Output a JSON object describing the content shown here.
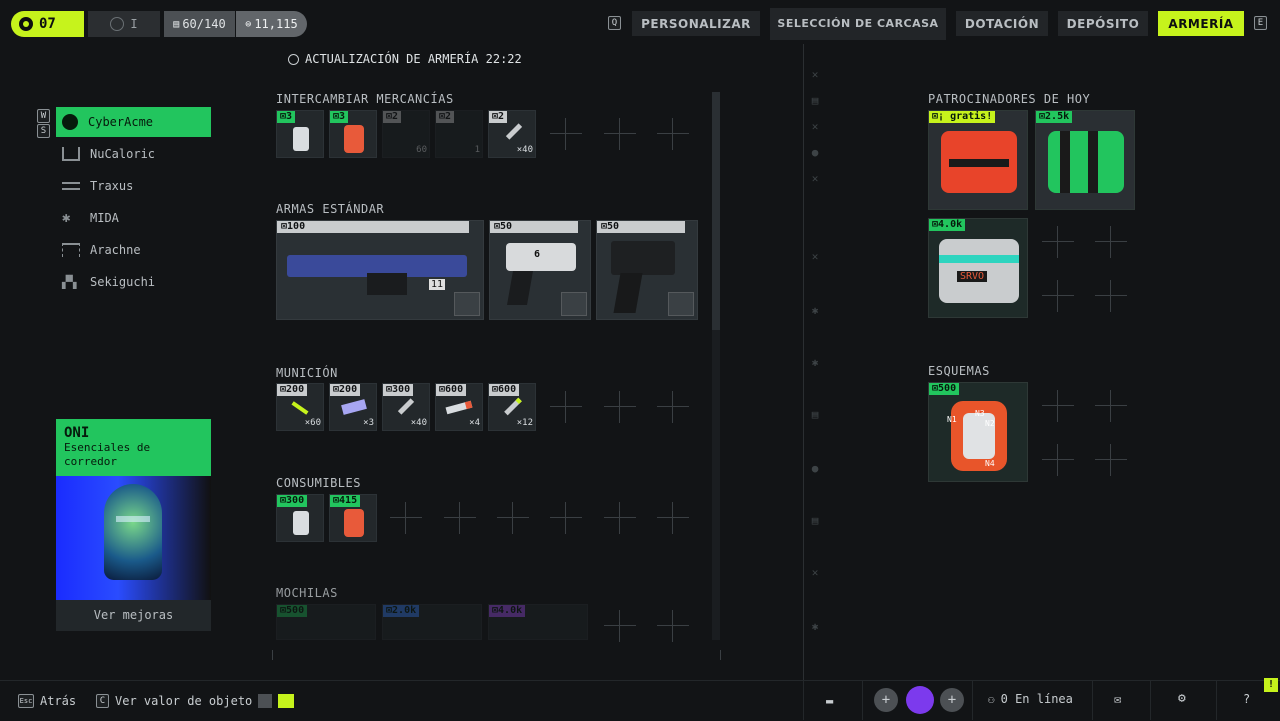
{
  "top": {
    "level": "07",
    "rank": "I",
    "capacity": "60/140",
    "credits": "11,115",
    "key_left": "Q",
    "key_right": "E",
    "nav": [
      "PERSONALIZAR",
      "SELECCIÓN DE CARCASA",
      "DOTACIÓN",
      "DEPÓSITO",
      "ARMERÍA"
    ],
    "active_nav": "ARMERÍA"
  },
  "armory": {
    "update_label": "ACTUALIZACIÓN DE ARMERÍA 22:22",
    "key_w": "W",
    "key_s": "S"
  },
  "factions": [
    "CyberAcme",
    "NuCaloric",
    "Traxus",
    "MIDA",
    "Arachne",
    "Sekiguchi"
  ],
  "promo": {
    "title": "ONI",
    "subtitle": "Esenciales de corredor",
    "button": "Ver mejoras"
  },
  "sections": {
    "trade": {
      "title": "INTERCAMBIAR MERCANCÍAS",
      "items": [
        {
          "price": "3",
          "qty": ""
        },
        {
          "price": "3",
          "qty": ""
        },
        {
          "price": "2",
          "qty": "60"
        },
        {
          "price": "2",
          "qty": "1"
        },
        {
          "price": "2",
          "qty": "×40"
        }
      ]
    },
    "weapons": {
      "title": "ARMAS ESTÁNDAR",
      "items": [
        {
          "price": "100",
          "tag": "11"
        },
        {
          "price": "50",
          "tag": "6"
        },
        {
          "price": "50",
          "tag": ""
        }
      ]
    },
    "ammo": {
      "title": "MUNICIÓN",
      "items": [
        {
          "price": "200",
          "qty": "×60"
        },
        {
          "price": "200",
          "qty": "×3"
        },
        {
          "price": "300",
          "qty": "×40"
        },
        {
          "price": "600",
          "qty": "×4"
        },
        {
          "price": "600",
          "qty": "×12"
        }
      ]
    },
    "consumables": {
      "title": "CONSUMIBLES",
      "items": [
        {
          "price": "300"
        },
        {
          "price": "415"
        }
      ]
    },
    "backpacks": {
      "title": "MOCHILAS",
      "items": [
        {
          "price": "500"
        },
        {
          "price": "2.0k"
        },
        {
          "price": "4.0k"
        }
      ]
    }
  },
  "sponsors": {
    "title": "PATROCINADORES DE HOY",
    "items": [
      {
        "price": "¡ gratis!",
        "tag": ""
      },
      {
        "price": "2.5k",
        "tag": ""
      },
      {
        "price": "4.0k",
        "tag": "SRVO"
      }
    ]
  },
  "schemes": {
    "title": "ESQUEMAS",
    "items": [
      {
        "price": "500",
        "tags": [
          "N1",
          "N2",
          "N3",
          "N4"
        ]
      }
    ]
  },
  "bottom": {
    "back_key": "Esc",
    "back": "Atrás",
    "value_key": "C",
    "value": "Ver valor de objeto",
    "online": "0 En línea",
    "help": "?",
    "alert": "!"
  },
  "colors": {
    "accent_lime": "#c6f31c",
    "accent_green": "#22c55e",
    "background": "#121416"
  }
}
